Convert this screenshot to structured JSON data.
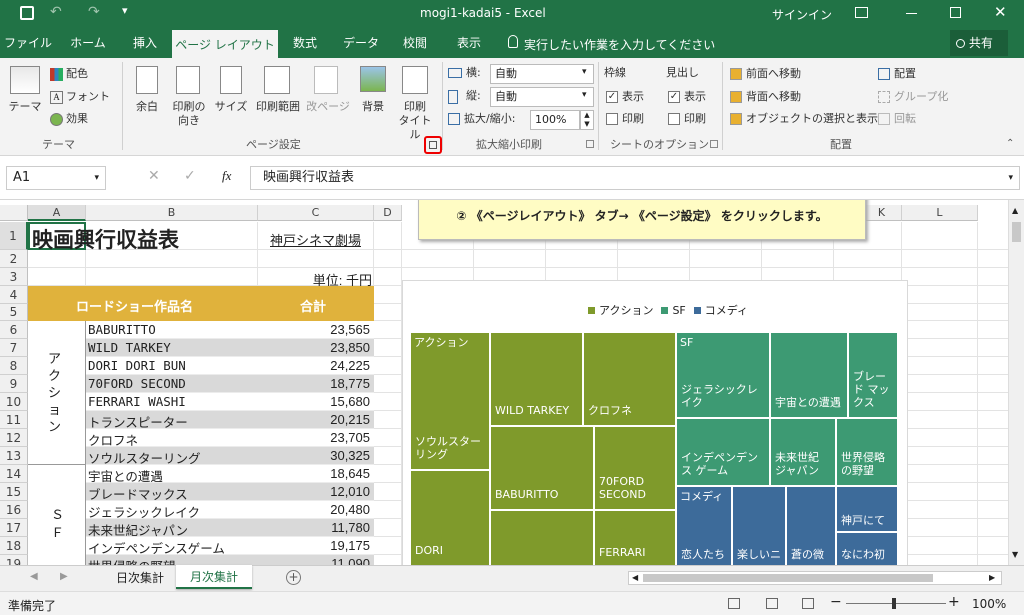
{
  "window": {
    "title": "mogi1-kadai5 - Excel",
    "signin": "サインイン"
  },
  "tabs": [
    {
      "label": "ファイル"
    },
    {
      "label": "ホーム"
    },
    {
      "label": "挿入"
    },
    {
      "label": "ページ レイアウト"
    },
    {
      "label": "数式"
    },
    {
      "label": "データ"
    },
    {
      "label": "校閲"
    },
    {
      "label": "表示"
    }
  ],
  "tellme": "実行したい作業を入力してください",
  "share": "共有",
  "ribbon": {
    "theme": {
      "label": "テーマ",
      "colors": "配色",
      "fonts": "フォント",
      "effects": "効果",
      "group": "テーマ"
    },
    "page": {
      "margins": "余白",
      "orientation_1": "印刷の",
      "orientation_2": "向き",
      "size": "サイズ",
      "print_area": "印刷範囲",
      "breaks": "改ページ",
      "background": "背景",
      "titles_1": "印刷",
      "titles_2": "タイトル",
      "group": "ページ設定"
    },
    "scale": {
      "width_label": "横:",
      "width_value": "自動",
      "height_label": "縦:",
      "height_value": "自動",
      "scale_label": "拡大/縮小:",
      "scale_value": "100%",
      "group": "拡大縮小印刷"
    },
    "sheet": {
      "gridlines": "枠線",
      "headings": "見出し",
      "view": "表示",
      "print": "印刷",
      "group": "シートのオプション"
    },
    "arrange": {
      "forward": "前面へ移動",
      "backward": "背面へ移動",
      "selection": "オブジェクトの選択と表示",
      "align": "配置",
      "group_btn": "グループ化",
      "rotate": "回転",
      "group": "配置"
    }
  },
  "formula": {
    "namebox": "A1",
    "content": "映画興行収益表"
  },
  "columns": [
    "A",
    "B",
    "C",
    "D",
    "K",
    "L"
  ],
  "callout": "② 《ページレイアウト》 タブ→ 《ページ設定》 をクリックします。",
  "sheet": {
    "title": "映画興行収益表",
    "theater": "神戸シネマ劇場",
    "unit": "単位: 千円",
    "header_name": "ロードショー作品名",
    "header_total": "合計",
    "group_action": "アクション",
    "group_sf_1": "Ｓ",
    "group_sf_2": "Ｆ",
    "rows": [
      {
        "n": "6",
        "name": "BABURITTO",
        "val": "23,565"
      },
      {
        "n": "7",
        "name": "WILD TARKEY",
        "val": "23,850"
      },
      {
        "n": "8",
        "name": "DORI DORI BUN",
        "val": "24,225"
      },
      {
        "n": "9",
        "name": "70FORD SECOND",
        "val": "18,775"
      },
      {
        "n": "10",
        "name": "FERRARI WASHI",
        "val": "15,680"
      },
      {
        "n": "11",
        "name": "トランスピーター",
        "val": "20,215"
      },
      {
        "n": "12",
        "name": "クロフネ",
        "val": "23,705"
      },
      {
        "n": "13",
        "name": "ソウルスターリング",
        "val": "30,325"
      },
      {
        "n": "14",
        "name": "宇宙との遭遇",
        "val": "18,645"
      },
      {
        "n": "15",
        "name": "ブレードマックス",
        "val": "12,010"
      },
      {
        "n": "16",
        "name": "ジェラシックレイク",
        "val": "20,480"
      },
      {
        "n": "17",
        "name": "未来世紀ジャパン",
        "val": "11,780"
      },
      {
        "n": "18",
        "name": "インデペンデンスゲーム",
        "val": "19,175"
      },
      {
        "n": "19",
        "name": "世界侵略の野望",
        "val": "11,090"
      }
    ]
  },
  "chart_data": {
    "type": "treemap",
    "legend": [
      "アクション",
      "SF",
      "コメディ"
    ],
    "legend_position": "top",
    "colors": {
      "action": "#7f9a2b",
      "sf": "#3d9a73",
      "comedy": "#3d6b9a"
    },
    "series": [
      {
        "name": "アクション",
        "items": [
          {
            "label": "ソウルスターリング",
            "value": 30325
          },
          {
            "label": "WILD TARKEY",
            "value": 23850
          },
          {
            "label": "クロフネ",
            "value": 23705
          },
          {
            "label": "BABURITTO",
            "value": 23565
          },
          {
            "label": "70FORD SECOND",
            "value": 18775
          },
          {
            "label": "DORI",
            "value": 24225
          },
          {
            "label": "FERRARI",
            "value": 15680
          },
          {
            "label": "",
            "value": 20215
          }
        ]
      },
      {
        "name": "SF",
        "items": [
          {
            "label": "ジェラシックレイク",
            "value": 20480
          },
          {
            "label": "宇宙との遭遇",
            "value": 18645
          },
          {
            "label": "ブレード マックス",
            "value": 12010
          },
          {
            "label": "インデペンデンス ゲーム",
            "value": 19175
          },
          {
            "label": "未来世紀 ジャパン",
            "value": 11780
          },
          {
            "label": "世界侵略 の野望",
            "value": 11090
          }
        ]
      },
      {
        "name": "コメディ",
        "items": [
          {
            "label": "恋人たち",
            "value": 0
          },
          {
            "label": "楽しいニ",
            "value": 0
          },
          {
            "label": "蒼の微",
            "value": 0
          },
          {
            "label": "神戸にて",
            "value": 0
          },
          {
            "label": "なにわ初",
            "value": 0
          }
        ]
      }
    ],
    "group_labels": [
      "アクション",
      "SF",
      "コメディ"
    ]
  },
  "sheettabs": [
    {
      "label": "日次集計"
    },
    {
      "label": "月次集計"
    }
  ],
  "status": {
    "ready": "準備完了",
    "zoom": "100%"
  }
}
